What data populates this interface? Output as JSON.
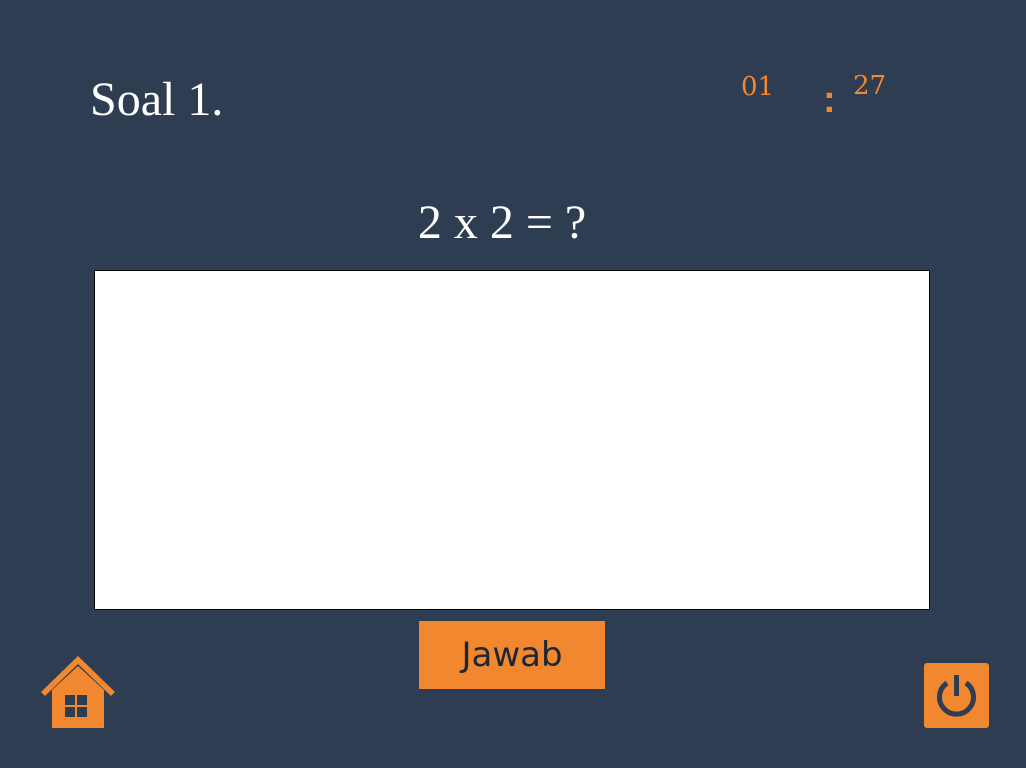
{
  "quiz": {
    "question_number": "Soal 1.",
    "question": "2 x 2 = ?"
  },
  "timer": {
    "minutes": "01",
    "separator": ":",
    "seconds": "27"
  },
  "answer": {
    "value": "",
    "placeholder": ""
  },
  "buttons": {
    "answer_label": "Jawab",
    "home_icon": "home-icon",
    "power_icon": "power-icon"
  },
  "colors": {
    "background": "#2e3d51",
    "accent": "#f1872f",
    "text": "#ffffff"
  }
}
